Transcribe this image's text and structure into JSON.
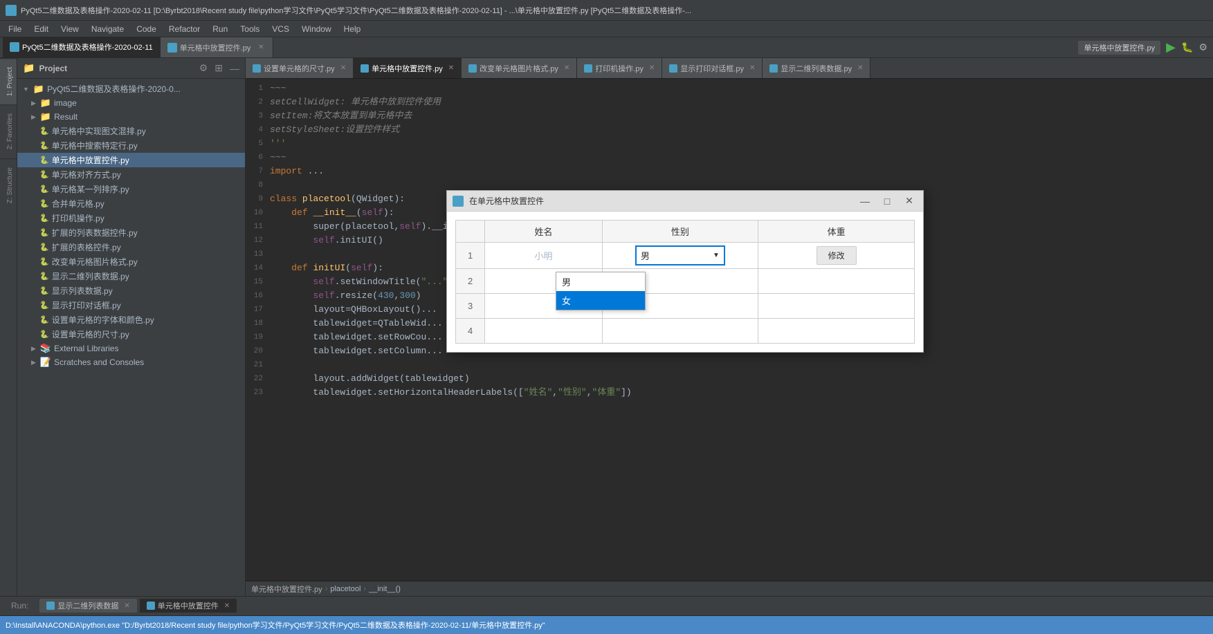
{
  "titlebar": {
    "title": "PyQt5二维数据及表格操作-2020-02-11 [D:\\Byrbt2018\\Recent study file\\python学习文件\\PyQt5学习文件\\PyQt5二维数据及表格操作-2020-02-11] - ...\\单元格中放置控件.py [PyQt5二维数据及表格操作-..."
  },
  "menubar": {
    "items": [
      "File",
      "Edit",
      "View",
      "Navigate",
      "Code",
      "Refactor",
      "Run",
      "Tools",
      "VCS",
      "Window",
      "Help"
    ]
  },
  "top_tabs": [
    {
      "label": "PyQt5二维数据及表格操作-2020-02-11",
      "active": true,
      "closable": false
    },
    {
      "label": "单元格中放置控件.py",
      "active": false,
      "closable": true
    }
  ],
  "editor_tabs": [
    {
      "label": "设置单元格的尺寸.py",
      "active": false
    },
    {
      "label": "单元格中放置控件.py",
      "active": true
    },
    {
      "label": "改变单元格图片格式.py",
      "active": false
    },
    {
      "label": "打印机操作.py",
      "active": false
    },
    {
      "label": "显示打印对话框.py",
      "active": false
    },
    {
      "label": "显示二维列表数据.py",
      "active": false
    }
  ],
  "project_panel": {
    "title": "Project",
    "root": "PyQt5二维数据及表格操作-2020-0..."
  },
  "file_tree": [
    {
      "type": "folder",
      "label": "image",
      "indent": 1,
      "expanded": false
    },
    {
      "type": "folder",
      "label": "Result",
      "indent": 1,
      "expanded": false
    },
    {
      "type": "file",
      "label": "单元格中实现图文混排.py",
      "indent": 2
    },
    {
      "type": "file",
      "label": "单元格中搜索特定行.py",
      "indent": 2
    },
    {
      "type": "file",
      "label": "单元格中放置控件.py",
      "indent": 2,
      "selected": true
    },
    {
      "type": "file",
      "label": "单元格对齐方式.py",
      "indent": 2
    },
    {
      "type": "file",
      "label": "单元格某一列排序.py",
      "indent": 2
    },
    {
      "type": "file",
      "label": "合并单元格.py",
      "indent": 2
    },
    {
      "type": "file",
      "label": "打印机操作.py",
      "indent": 2
    },
    {
      "type": "file",
      "label": "扩展的列表数据控件.py",
      "indent": 2
    },
    {
      "type": "file",
      "label": "扩展的表格控件.py",
      "indent": 2
    },
    {
      "type": "file",
      "label": "改变单元格图片格式.py",
      "indent": 2
    },
    {
      "type": "file",
      "label": "显示二维列表数据.py",
      "indent": 2
    },
    {
      "type": "file",
      "label": "显示列表数据.py",
      "indent": 2
    },
    {
      "type": "file",
      "label": "显示打印对话框.py",
      "indent": 2
    },
    {
      "type": "file",
      "label": "设置单元格的字体和颜色.py",
      "indent": 2
    },
    {
      "type": "file",
      "label": "设置单元格的尺寸.py",
      "indent": 2
    },
    {
      "type": "folder",
      "label": "External Libraries",
      "indent": 1,
      "expanded": false
    },
    {
      "type": "folder",
      "label": "Scratches and Consoles",
      "indent": 1,
      "expanded": false
    }
  ],
  "code_lines": [
    {
      "num": "1",
      "content": "~~~~"
    },
    {
      "num": "2",
      "content": "setCellWidget: 单元格中放到控件使用",
      "style": "comment"
    },
    {
      "num": "3",
      "content": "setItem:将文本放置到单元格中去",
      "style": "comment"
    },
    {
      "num": "4",
      "content": "setStyleSheet:设置控件样式",
      "style": "comment"
    },
    {
      "num": "5",
      "content": "'''",
      "style": "str"
    },
    {
      "num": "6",
      "content": "~~~~"
    },
    {
      "num": "7",
      "content": "import ...",
      "style": "normal"
    },
    {
      "num": "8",
      "content": ""
    },
    {
      "num": "9",
      "content": "class placetool(QWidget):",
      "style": "class"
    },
    {
      "num": "10",
      "content": "    def __init__(self):",
      "style": "def"
    },
    {
      "num": "11",
      "content": "        super(placetool,self).__init__()",
      "style": "normal"
    },
    {
      "num": "12",
      "content": "        self.initUI()",
      "style": "normal"
    },
    {
      "num": "13",
      "content": ""
    },
    {
      "num": "14",
      "content": "    def initUI(self):",
      "style": "def"
    },
    {
      "num": "15",
      "content": "        self.setWindowTitle(\"...\")",
      "style": "normal"
    },
    {
      "num": "16",
      "content": "        self.resize(430,300)",
      "style": "normal"
    },
    {
      "num": "17",
      "content": "        layout=QHBoxLayout()...",
      "style": "normal"
    },
    {
      "num": "18",
      "content": "        tablewidget=QTableWid...",
      "style": "normal"
    },
    {
      "num": "19",
      "content": "        tablewidget.setRowCou...",
      "style": "normal"
    },
    {
      "num": "20",
      "content": "        tablewidget.setColumn...",
      "style": "normal"
    },
    {
      "num": "21",
      "content": ""
    },
    {
      "num": "22",
      "content": "        layout.addWidget(tablewidget)",
      "style": "normal"
    },
    {
      "num": "23",
      "content": "        tablewidget.setHorizontalHeaderLabels([\"姓名\",\"性别\",\"体重\"])",
      "style": "normal"
    }
  ],
  "breadcrumb": {
    "items": [
      "placetool",
      "__init__()"
    ]
  },
  "run_tabs": [
    {
      "label": "显示二维列表数据",
      "active": false
    },
    {
      "label": "单元格中放置控件",
      "active": true
    }
  ],
  "run_label": "Run:",
  "status_bar": {
    "text": "D:\\Install\\ANACONDA\\python.exe \"D:/Byrbt2018/Recent study file/python学习文件/PyQt5学习文件/PyQt5二维数据及表格操作-2020-02-11/单元格中放置控件.py\""
  },
  "dialog": {
    "title": "在单元格中放置控件",
    "columns": [
      "姓名",
      "性别",
      "体重"
    ],
    "rows": [
      {
        "num": "1",
        "name": "小明",
        "gender": "男",
        "weight": "",
        "has_btn": true
      },
      {
        "num": "2",
        "name": "",
        "gender": "",
        "weight": "",
        "has_btn": false
      },
      {
        "num": "3",
        "name": "",
        "gender": "",
        "weight": "",
        "has_btn": false
      },
      {
        "num": "4",
        "name": "",
        "gender": "",
        "weight": "",
        "has_btn": false
      }
    ],
    "modify_btn": "修改",
    "dropdown_options": [
      "男",
      "女"
    ],
    "selected_option": "女",
    "selected_gender": "男"
  },
  "left_edge_tabs": [
    {
      "label": "1: Project",
      "active": true
    },
    {
      "label": "2: Favorites",
      "active": false
    },
    {
      "label": "Z: Structure",
      "active": false
    }
  ]
}
